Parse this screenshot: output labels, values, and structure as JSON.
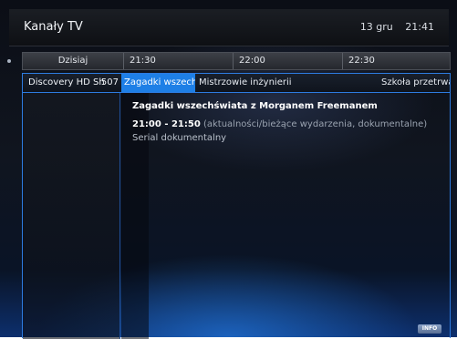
{
  "header": {
    "title": "Kanały TV",
    "date": "13 gru",
    "time": "21:41"
  },
  "timeline": {
    "day": "Dzisiaj",
    "slots": [
      "21:30",
      "22:00",
      "22:30"
    ]
  },
  "channel": {
    "name": "Discovery HD Sh",
    "number": "507",
    "programs": [
      {
        "title": "Zagadki wszechś",
        "selected": true
      },
      {
        "title": "Mistrzowie inżynierii",
        "selected": false
      },
      {
        "title": "Szkoła przetrwan",
        "selected": false
      }
    ]
  },
  "details": {
    "title": "Zagadki wszechświata z Morganem Freemanem",
    "time_range": "21:00 - 21:50",
    "genre": "(aktualności/bieżące wydarzenia, dokumentalne)",
    "description": "Serial dokumentalny"
  },
  "buttons": {
    "info_label": "INFO"
  },
  "colors": {
    "accent": "#1e7fe6",
    "border": "#2d7be0"
  }
}
